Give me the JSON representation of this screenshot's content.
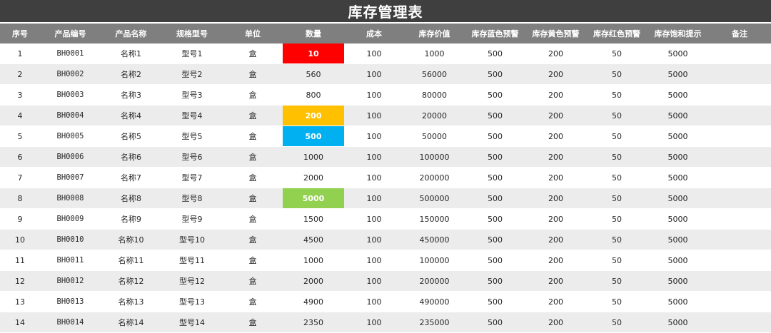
{
  "title": "库存管理表",
  "headers": {
    "seq": "序号",
    "code": "产品编号",
    "name": "产品名称",
    "model": "规格型号",
    "unit": "单位",
    "qty": "数量",
    "cost": "成本",
    "value": "库存价值",
    "blue_warn": "库存蓝色预警",
    "yellow_warn": "库存黄色预警",
    "red_warn": "库存红色预警",
    "saturation": "库存饱和提示",
    "note": "备注"
  },
  "colors": {
    "title_bg": "#3f3f3f",
    "header_bg": "#7f7f7f",
    "alt_row_bg": "#ececec",
    "red_alert": "#ff0000",
    "yellow_alert": "#ffc000",
    "blue_alert": "#00b0f0",
    "saturation_alert": "#92d050"
  },
  "rows": [
    {
      "seq": "1",
      "code": "BH0001",
      "name": "名称1",
      "model": "型号1",
      "unit": "盒",
      "qty": "10",
      "cost": "100",
      "value": "1000",
      "blue_warn": "500",
      "yellow_warn": "200",
      "red_warn": "50",
      "saturation": "5000",
      "note": "",
      "alert": "red"
    },
    {
      "seq": "2",
      "code": "BH0002",
      "name": "名称2",
      "model": "型号2",
      "unit": "盒",
      "qty": "560",
      "cost": "100",
      "value": "56000",
      "blue_warn": "500",
      "yellow_warn": "200",
      "red_warn": "50",
      "saturation": "5000",
      "note": "",
      "alert": ""
    },
    {
      "seq": "3",
      "code": "BH0003",
      "name": "名称3",
      "model": "型号3",
      "unit": "盒",
      "qty": "800",
      "cost": "100",
      "value": "80000",
      "blue_warn": "500",
      "yellow_warn": "200",
      "red_warn": "50",
      "saturation": "5000",
      "note": "",
      "alert": ""
    },
    {
      "seq": "4",
      "code": "BH0004",
      "name": "名称4",
      "model": "型号4",
      "unit": "盒",
      "qty": "200",
      "cost": "100",
      "value": "20000",
      "blue_warn": "500",
      "yellow_warn": "200",
      "red_warn": "50",
      "saturation": "5000",
      "note": "",
      "alert": "yellow"
    },
    {
      "seq": "5",
      "code": "BH0005",
      "name": "名称5",
      "model": "型号5",
      "unit": "盒",
      "qty": "500",
      "cost": "100",
      "value": "50000",
      "blue_warn": "500",
      "yellow_warn": "200",
      "red_warn": "50",
      "saturation": "5000",
      "note": "",
      "alert": "blue"
    },
    {
      "seq": "6",
      "code": "BH0006",
      "name": "名称6",
      "model": "型号6",
      "unit": "盒",
      "qty": "1000",
      "cost": "100",
      "value": "100000",
      "blue_warn": "500",
      "yellow_warn": "200",
      "red_warn": "50",
      "saturation": "5000",
      "note": "",
      "alert": ""
    },
    {
      "seq": "7",
      "code": "BH0007",
      "name": "名称7",
      "model": "型号7",
      "unit": "盒",
      "qty": "2000",
      "cost": "100",
      "value": "200000",
      "blue_warn": "500",
      "yellow_warn": "200",
      "red_warn": "50",
      "saturation": "5000",
      "note": "",
      "alert": ""
    },
    {
      "seq": "8",
      "code": "BH0008",
      "name": "名称8",
      "model": "型号8",
      "unit": "盒",
      "qty": "5000",
      "cost": "100",
      "value": "500000",
      "blue_warn": "500",
      "yellow_warn": "200",
      "red_warn": "50",
      "saturation": "5000",
      "note": "",
      "alert": "green"
    },
    {
      "seq": "9",
      "code": "BH0009",
      "name": "名称9",
      "model": "型号9",
      "unit": "盒",
      "qty": "1500",
      "cost": "100",
      "value": "150000",
      "blue_warn": "500",
      "yellow_warn": "200",
      "red_warn": "50",
      "saturation": "5000",
      "note": "",
      "alert": ""
    },
    {
      "seq": "10",
      "code": "BH0010",
      "name": "名称10",
      "model": "型号10",
      "unit": "盒",
      "qty": "4500",
      "cost": "100",
      "value": "450000",
      "blue_warn": "500",
      "yellow_warn": "200",
      "red_warn": "50",
      "saturation": "5000",
      "note": "",
      "alert": ""
    },
    {
      "seq": "11",
      "code": "BH0011",
      "name": "名称11",
      "model": "型号11",
      "unit": "盒",
      "qty": "1000",
      "cost": "100",
      "value": "100000",
      "blue_warn": "500",
      "yellow_warn": "200",
      "red_warn": "50",
      "saturation": "5000",
      "note": "",
      "alert": ""
    },
    {
      "seq": "12",
      "code": "BH0012",
      "name": "名称12",
      "model": "型号12",
      "unit": "盒",
      "qty": "2000",
      "cost": "100",
      "value": "200000",
      "blue_warn": "500",
      "yellow_warn": "200",
      "red_warn": "50",
      "saturation": "5000",
      "note": "",
      "alert": ""
    },
    {
      "seq": "13",
      "code": "BH0013",
      "name": "名称13",
      "model": "型号13",
      "unit": "盒",
      "qty": "4900",
      "cost": "100",
      "value": "490000",
      "blue_warn": "500",
      "yellow_warn": "200",
      "red_warn": "50",
      "saturation": "5000",
      "note": "",
      "alert": ""
    },
    {
      "seq": "14",
      "code": "BH0014",
      "name": "名称14",
      "model": "型号14",
      "unit": "盒",
      "qty": "2350",
      "cost": "100",
      "value": "235000",
      "blue_warn": "500",
      "yellow_warn": "200",
      "red_warn": "50",
      "saturation": "5000",
      "note": "",
      "alert": ""
    }
  ]
}
